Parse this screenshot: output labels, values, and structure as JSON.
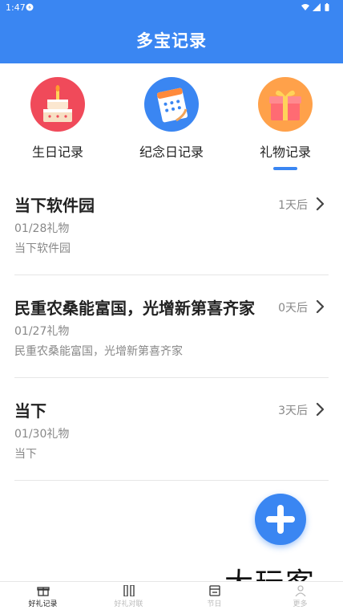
{
  "status_bar": {
    "time": "1:47"
  },
  "app_bar": {
    "title": "多宝记录"
  },
  "categories": [
    {
      "label": "生日记录",
      "icon": "birthday-cake-icon"
    },
    {
      "label": "纪念日记录",
      "icon": "calendar-icon"
    },
    {
      "label": "礼物记录",
      "icon": "gift-box-icon",
      "selected": true
    }
  ],
  "records": [
    {
      "name": "当下软件园",
      "date": "01/28礼物",
      "desc": "当下软件园",
      "days": "1天后"
    },
    {
      "name": "民重农桑能富国，光增新第喜齐家",
      "date": "01/27礼物",
      "desc": "民重农桑能富国，光增新第喜齐家",
      "days": "0天后"
    },
    {
      "name": "当下",
      "date": "01/30礼物",
      "desc": "当下",
      "days": "3天后"
    }
  ],
  "watermark": "大玩客",
  "tabs": [
    {
      "label": "好礼记录",
      "icon": "gift-icon",
      "active": true
    },
    {
      "label": "好礼对联",
      "icon": "couplet-icon"
    },
    {
      "label": "节日",
      "icon": "calendar-icon"
    },
    {
      "label": "更多",
      "icon": "person-icon"
    }
  ],
  "colors": {
    "primary": "#3a86f2",
    "text": "#222222",
    "muted": "#888888"
  }
}
